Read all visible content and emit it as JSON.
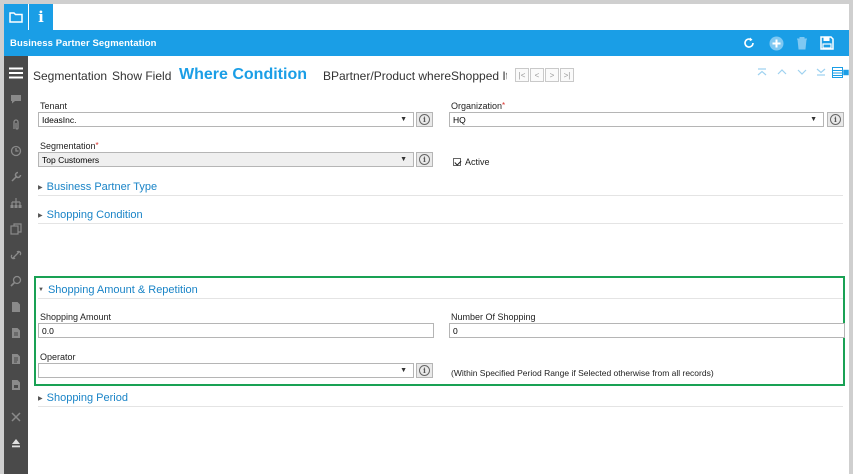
{
  "window": {
    "title": "Business Partner Segmentation",
    "top_tabs": [
      {
        "name": "folder-icon"
      },
      {
        "name": "info-icon",
        "glyph": "i"
      }
    ],
    "toolbar_icons": [
      "undo-icon",
      "add-icon",
      "delete-icon",
      "save-icon"
    ]
  },
  "sidebar": {
    "items": [
      "menu-icon",
      "chat-icon",
      "attachment-icon",
      "history-icon",
      "wrench-icon",
      "tree-icon",
      "copy-icon",
      "link-icon",
      "zoom-icon",
      "report-icon",
      "document-icon",
      "print-icon",
      "archive-icon",
      "close-icon",
      "eject-icon"
    ]
  },
  "tabs": {
    "items": [
      {
        "label": "Segmentation",
        "active": false
      },
      {
        "label": "Show Field",
        "active": false
      },
      {
        "label": "Where Condition",
        "active": true
      },
      {
        "label": "BPartner/Product where",
        "active": false
      },
      {
        "label": "Shopped Ite",
        "active": false
      }
    ],
    "pager": [
      "|<",
      "<",
      ">",
      ">|"
    ]
  },
  "form": {
    "tenant": {
      "label": "Tenant",
      "value": "IdeasInc."
    },
    "organization": {
      "label": "Organization",
      "required_mark": "*",
      "value": "HQ"
    },
    "segmentation": {
      "label": "Segmentation",
      "required_mark": "*",
      "value": "Top Customers"
    },
    "active": {
      "label": "Active",
      "checked": true
    }
  },
  "sections": {
    "bp_type": "Business Partner Type",
    "shopping_condition": "Shopping Condition",
    "amount_repetition": "Shopping Amount & Repetition",
    "shopping_period": "Shopping Period"
  },
  "amount": {
    "shopping_amount": {
      "label": "Shopping Amount",
      "value": "0.0"
    },
    "number_of_shopping": {
      "label": "Number Of Shopping",
      "value": "0"
    },
    "operator": {
      "label": "Operator",
      "value": ""
    },
    "note": "(Within Specified Period Range if Selected otherwise from all records)"
  },
  "colors": {
    "accent": "#1a9ee6",
    "highlight": "#19a154",
    "sidebar": "#4a4a4a"
  }
}
